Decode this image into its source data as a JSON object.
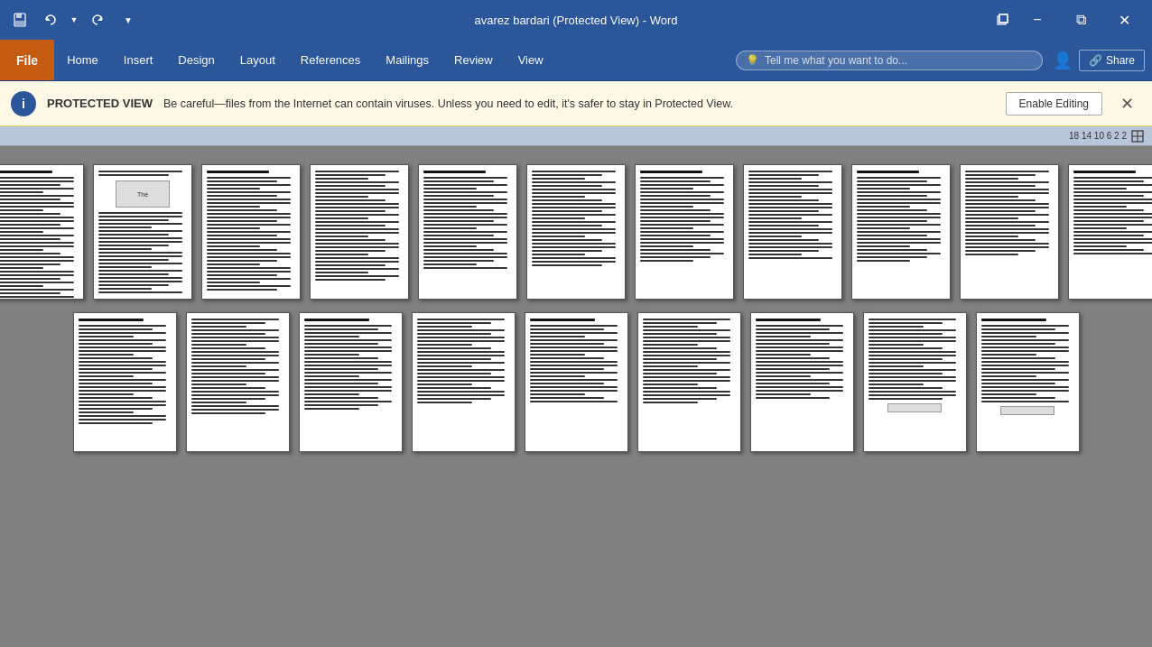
{
  "titleBar": {
    "title": "avarez bardari (Protected View) - Word",
    "saveIcon": "💾",
    "undoIcon": "↩",
    "redoIcon": "↪",
    "customizeIcon": "⌄",
    "minimizeLabel": "−",
    "restoreLabel": "⧉",
    "closeLabel": "✕",
    "restoreWindowIcon": "⊡"
  },
  "ribbon": {
    "fileLabel": "File",
    "tabs": [
      {
        "label": "Home",
        "active": false
      },
      {
        "label": "Insert",
        "active": false
      },
      {
        "label": "Design",
        "active": false
      },
      {
        "label": "Layout",
        "active": false
      },
      {
        "label": "References",
        "active": false
      },
      {
        "label": "Mailings",
        "active": false
      },
      {
        "label": "Review",
        "active": false
      },
      {
        "label": "View",
        "active": false
      }
    ],
    "searchPlaceholder": "Tell me what you want to do...",
    "shareLabel": "Share"
  },
  "protectedView": {
    "label": "PROTECTED VIEW",
    "message": "Be careful—files from the Internet can contain viruses. Unless you need to edit, it's safer to stay in Protected View.",
    "enableLabel": "Enable Editing",
    "closeIcon": "✕"
  },
  "ruler": {
    "values": "18  14  10  6  2  2"
  },
  "pages": {
    "row1Count": 11,
    "row2Count": 9
  }
}
